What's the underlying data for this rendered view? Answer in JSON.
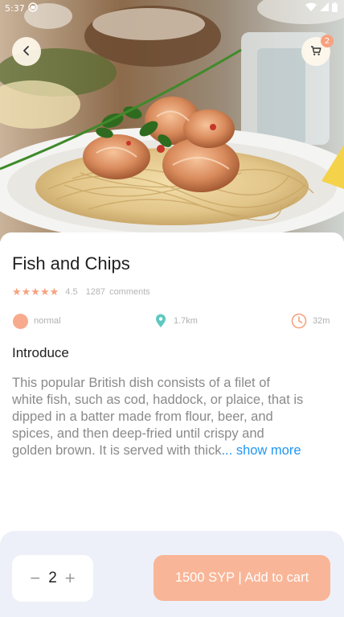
{
  "status_bar": {
    "time": "5:37",
    "icons": [
      "media-icon",
      "wifi-icon",
      "signal-icon",
      "battery-icon"
    ]
  },
  "header": {
    "back_icon": "chevron-left-icon",
    "cart_icon": "cart-icon",
    "cart_count": "2"
  },
  "product": {
    "title": "Fish and Chips",
    "stars": "★★★★★",
    "rating": "4.5",
    "comments_count": "1287",
    "comments_label": "comments",
    "level": "normal",
    "distance": "1.7km",
    "time": "32m",
    "section_heading": "Introduce",
    "description_lines": [
      "This popular British dish consists of a filet of",
      "white fish, such as cod, haddock, or plaice, that is",
      "dipped in a batter made from flour, beer, and",
      "spices, and then deep-fried until crispy and",
      "golden brown. It is served with thick"
    ],
    "ellipsis": "...",
    "show_more": " show more"
  },
  "cart_bar": {
    "decrement": "−",
    "quantity": "2",
    "increment": "+",
    "add_to_cart_label": "1500 SYP | Add to cart"
  },
  "colors": {
    "accent": "#f7a27f",
    "button": "#f9b597",
    "link": "#2196f3",
    "location": "#5ec9c0",
    "bottom_bar": "#edf0f8"
  }
}
